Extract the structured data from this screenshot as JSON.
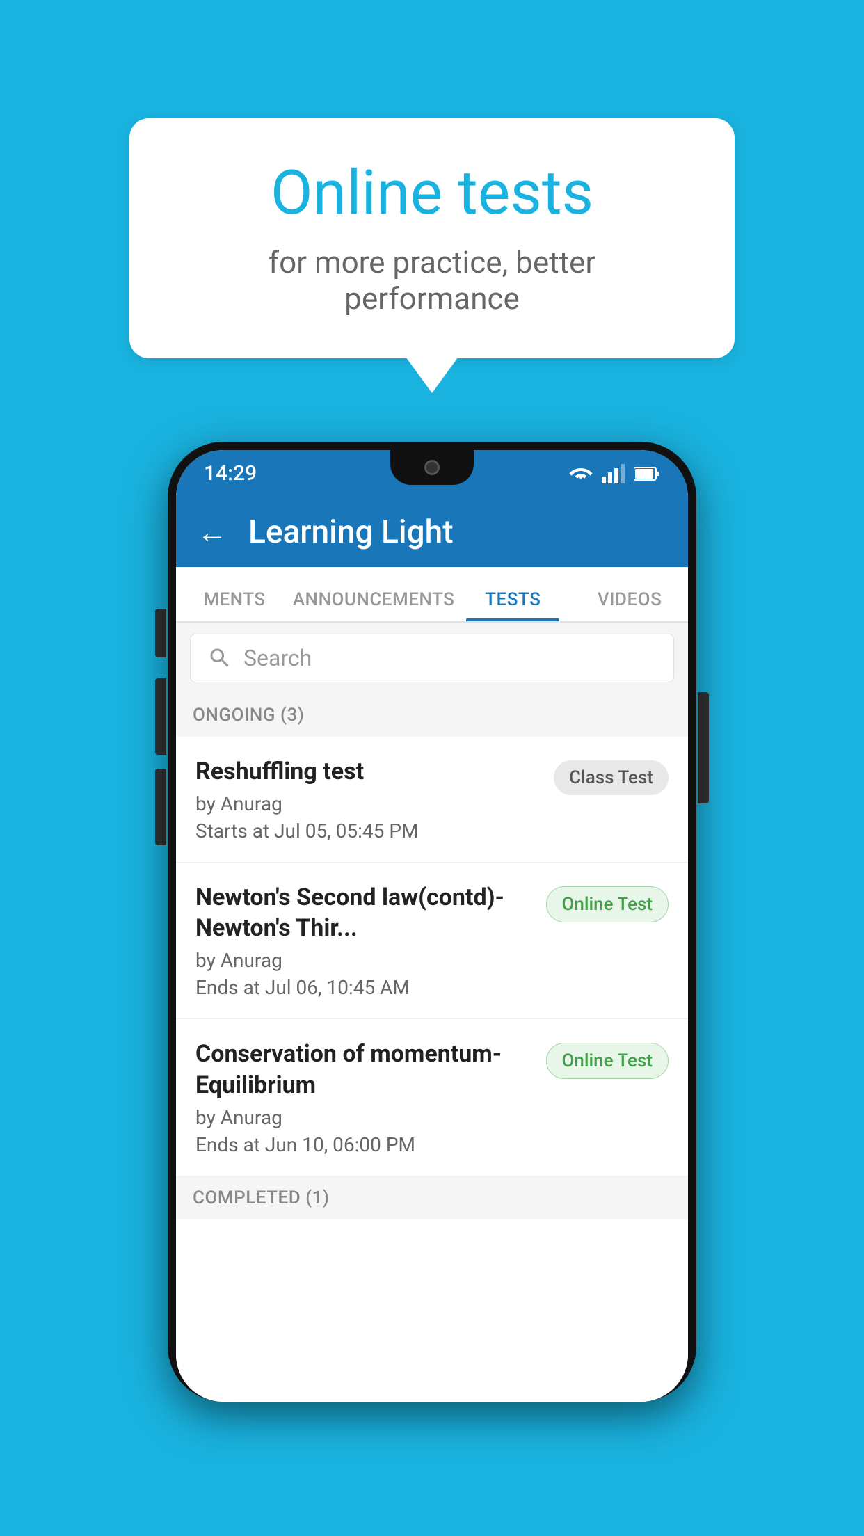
{
  "background_color": "#1ab3e0",
  "speech_bubble": {
    "title": "Online tests",
    "subtitle": "for more practice, better performance"
  },
  "phone": {
    "status_bar": {
      "time": "14:29",
      "wifi_icon": "▼",
      "signal_icon": "▲",
      "battery_icon": "▮"
    },
    "app_bar": {
      "back_label": "←",
      "title": "Learning Light"
    },
    "tabs": [
      {
        "label": "MENTS",
        "active": false
      },
      {
        "label": "ANNOUNCEMENTS",
        "active": false
      },
      {
        "label": "TESTS",
        "active": true
      },
      {
        "label": "VIDEOS",
        "active": false
      }
    ],
    "search": {
      "placeholder": "Search"
    },
    "ongoing_section": {
      "title": "ONGOING (3)"
    },
    "tests": [
      {
        "name": "Reshuffling test",
        "author": "by Anurag",
        "time_label": "Starts at",
        "time": "Jul 05, 05:45 PM",
        "badge": "Class Test",
        "badge_type": "class"
      },
      {
        "name": "Newton's Second law(contd)-Newton's Thir...",
        "author": "by Anurag",
        "time_label": "Ends at",
        "time": "Jul 06, 10:45 AM",
        "badge": "Online Test",
        "badge_type": "online"
      },
      {
        "name": "Conservation of momentum-Equilibrium",
        "author": "by Anurag",
        "time_label": "Ends at",
        "time": "Jun 10, 06:00 PM",
        "badge": "Online Test",
        "badge_type": "online"
      }
    ],
    "completed_section": {
      "title": "COMPLETED (1)"
    }
  }
}
